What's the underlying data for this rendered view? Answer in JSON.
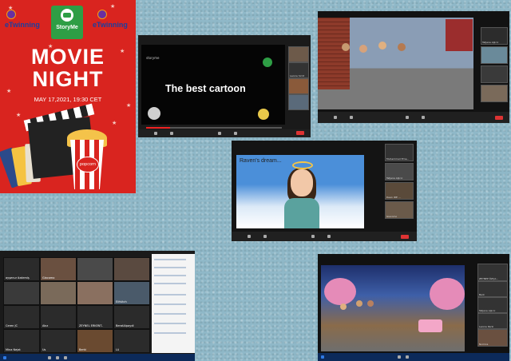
{
  "poster": {
    "etwinning_left": "eTwinning",
    "etwinning_right": "eTwinning",
    "storyme_label": "StoryMe",
    "title_line1": "MOVIE",
    "title_line2": "NIGHT",
    "date": "MAY 17,2021, 19:30 CET",
    "popcorn_label": "popcorn"
  },
  "window1": {
    "channel": "storyme",
    "caption": "The best cartoon",
    "participants": [
      "Leonie Sirrit"
    ]
  },
  "window2": {
    "participants": [
      "Tatjana Aljicic"
    ]
  },
  "window3": {
    "caption": "Raven's dream...",
    "participants": [
      "Muhammed Ema...",
      "Tatjana Aljicic",
      "Dean IDE ...",
      "Giacomo"
    ]
  },
  "window4": {
    "participants": [
      "ayşenur özdemiş",
      "Giacomo",
      "Elifsitch",
      "Ceren JC",
      "Akız",
      "ZEYNEL ERKENT..",
      "BeratAlpaydi",
      "Elif AyGEB",
      "Mina Nejat",
      "Us",
      "Berki",
      "Lü"
    ],
    "mute_label": "Mic"
  },
  "window5": {
    "participants": [
      "ZEYNEP ÖZÇA...",
      "Berk",
      "Tatjana Aljicic",
      "Leonie Perki",
      "Nomica"
    ]
  },
  "colors": {
    "poster_red": "#d9241f",
    "end_red": "#dd3333",
    "background": "#8fb8c8"
  }
}
